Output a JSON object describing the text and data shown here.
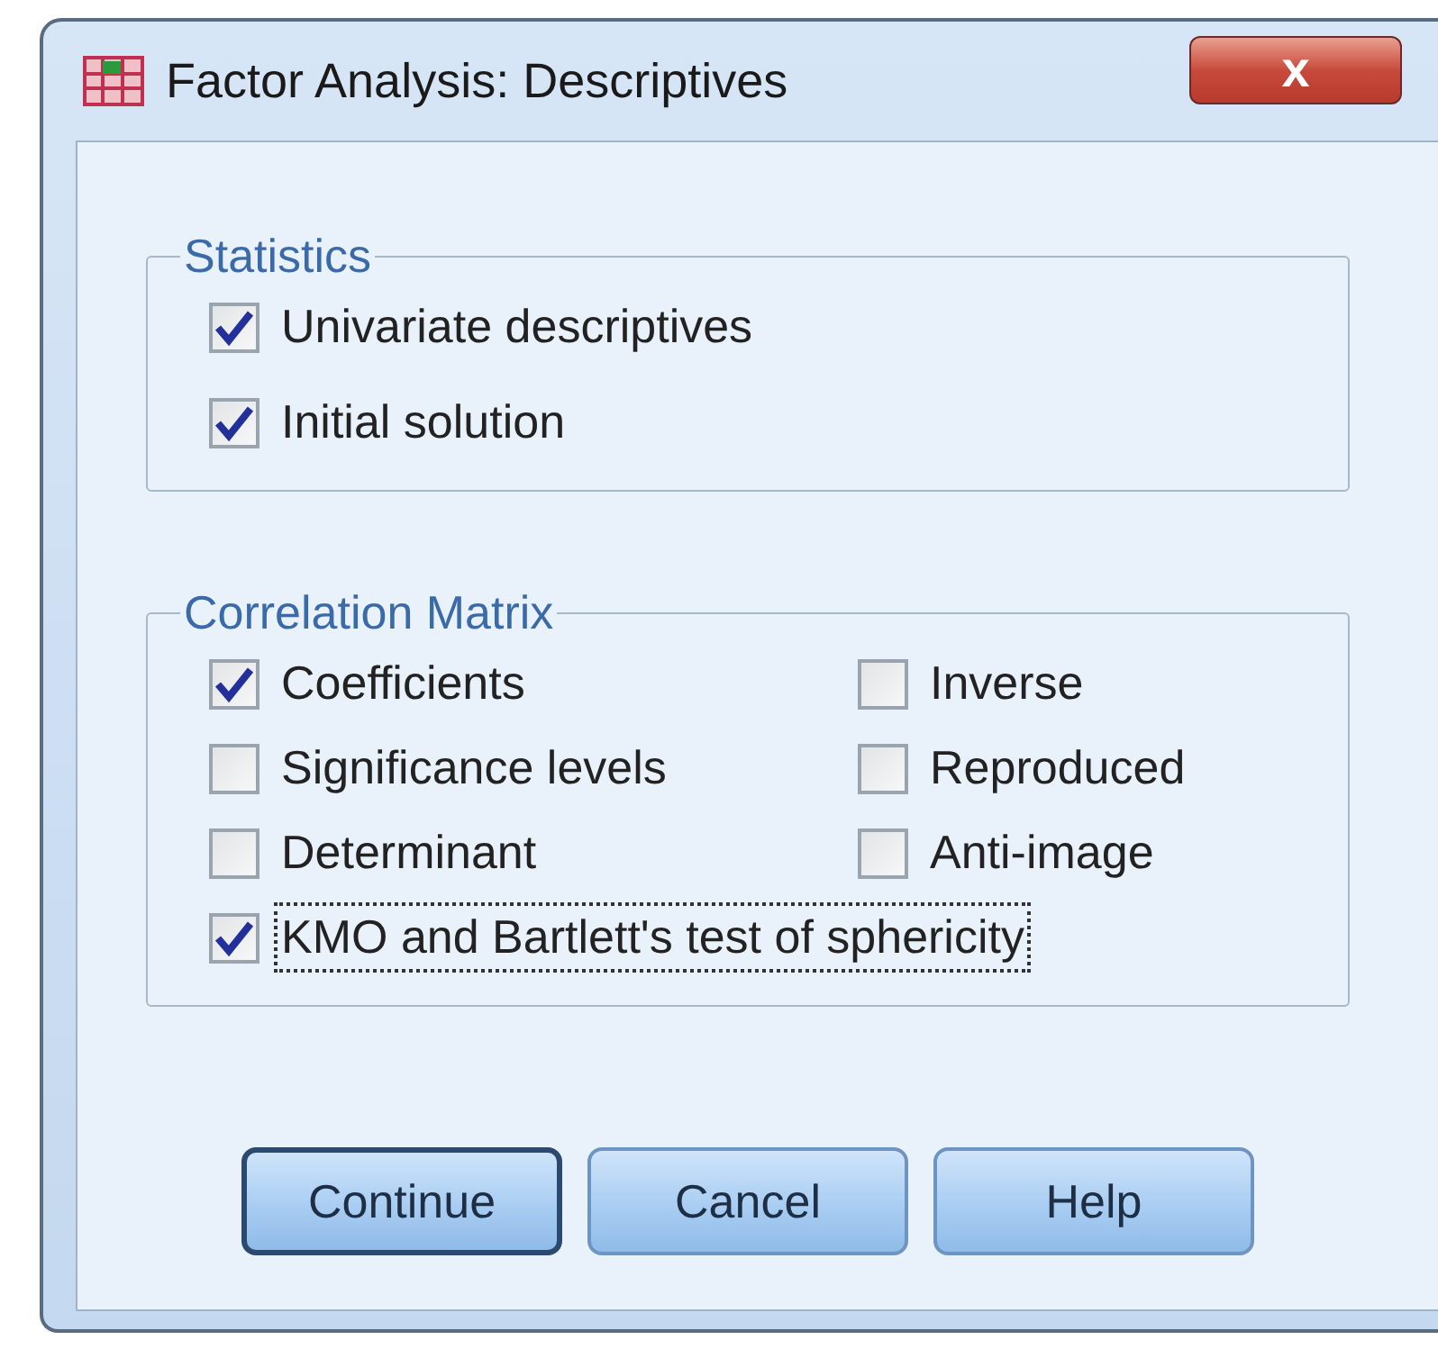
{
  "window": {
    "title": "Factor Analysis: Descriptives",
    "close_label": "x"
  },
  "groups": [
    {
      "title": "Statistics",
      "kind": "list",
      "items": [
        {
          "label": "Univariate descriptives",
          "checked": true,
          "focused": false
        },
        {
          "label": "Initial solution",
          "checked": true,
          "focused": false
        }
      ]
    },
    {
      "title": "Correlation Matrix",
      "kind": "grid",
      "items": [
        {
          "label": "Coefficients",
          "checked": true,
          "focused": false
        },
        {
          "label": "Inverse",
          "checked": false,
          "focused": false
        },
        {
          "label": "Significance levels",
          "checked": false,
          "focused": false
        },
        {
          "label": "Reproduced",
          "checked": false,
          "focused": false
        },
        {
          "label": "Determinant",
          "checked": false,
          "focused": false
        },
        {
          "label": "Anti-image",
          "checked": false,
          "focused": false
        },
        {
          "label": "KMO and Bartlett's test of sphericity",
          "checked": true,
          "focused": true,
          "kind": "wide"
        }
      ]
    }
  ],
  "buttons": [
    {
      "label": "Continue",
      "default": true
    },
    {
      "label": "Cancel",
      "default": false
    },
    {
      "label": "Help",
      "default": false
    }
  ]
}
